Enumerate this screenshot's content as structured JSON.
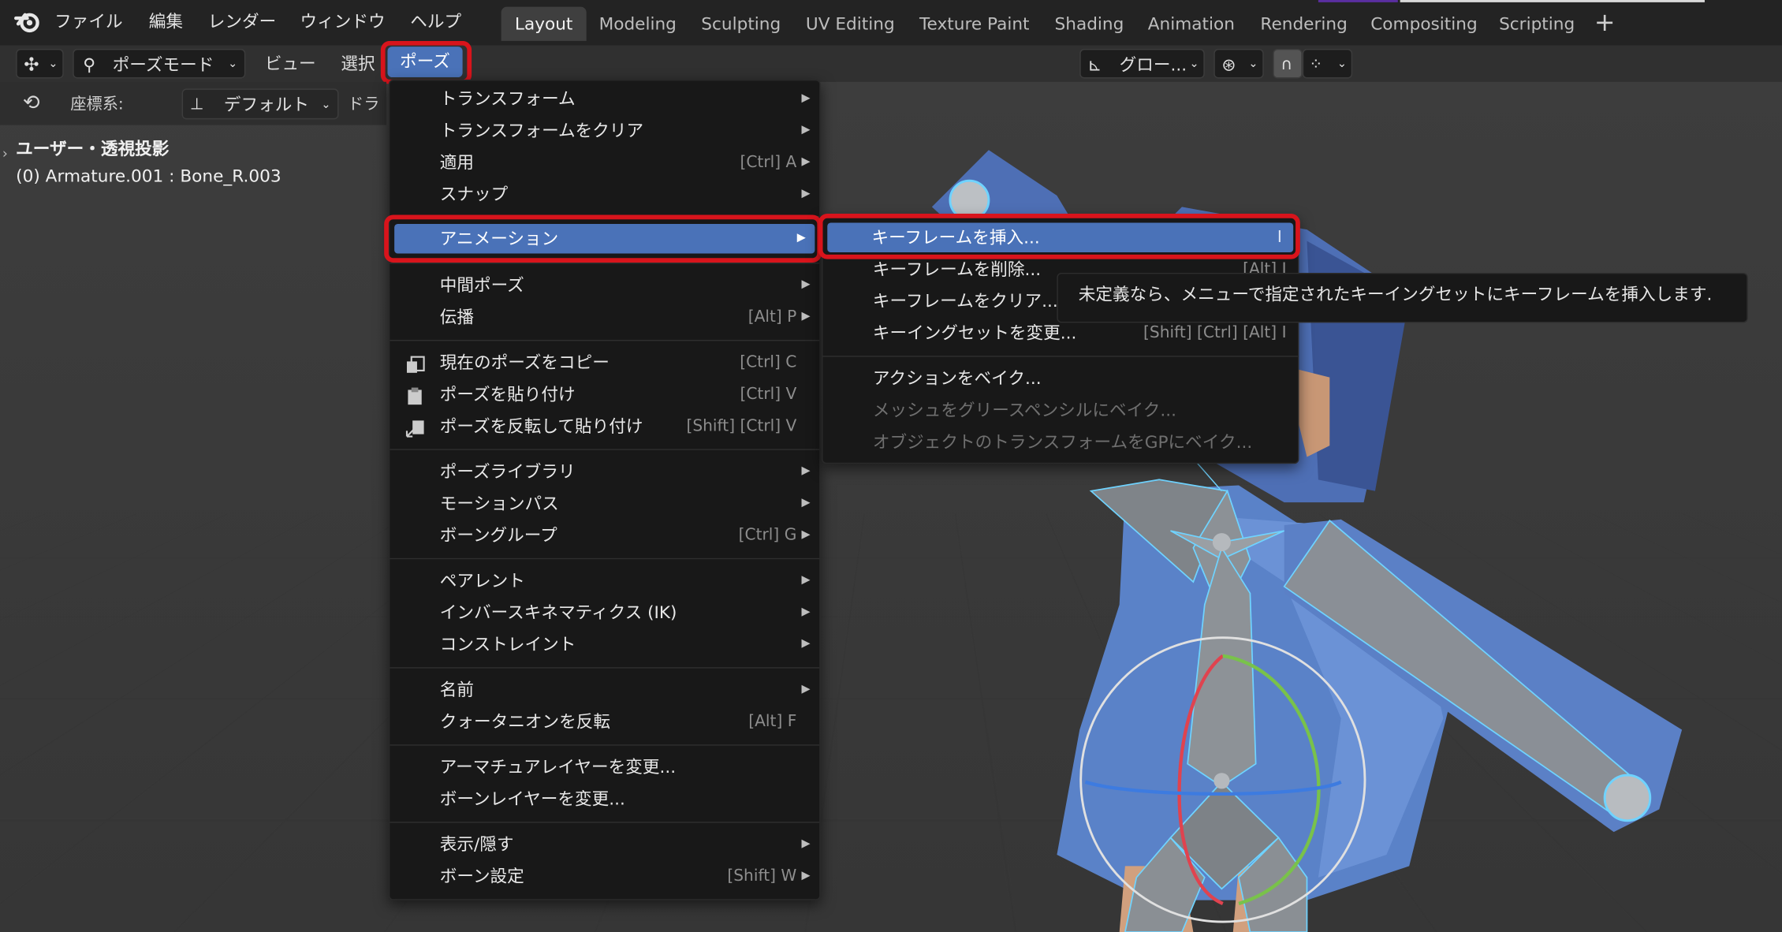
{
  "topbar": {
    "menus": [
      "ファイル",
      "編集",
      "レンダー",
      "ウィンドウ",
      "ヘルプ"
    ],
    "workspaces": [
      "Layout",
      "Modeling",
      "Sculpting",
      "UV Editing",
      "Texture Paint",
      "Shading",
      "Animation",
      "Rendering",
      "Compositing",
      "Scripting"
    ],
    "active_workspace": "Layout",
    "add_workspace": "+"
  },
  "header": {
    "mode": "ポーズモード",
    "view": "ビュー",
    "select": "選択",
    "pose": "ポーズ",
    "transform_orientation": "グロー...",
    "snap_icon": "magnet-icon"
  },
  "row3": {
    "coordinate_label": "座標系:",
    "coordinate_value": "デフォルト",
    "drag_label": "ドラ"
  },
  "overlay": {
    "view_name": "ユーザー・透視投影",
    "object_info": "(0) Armature.001 : Bone_R.003"
  },
  "pose_menu": {
    "items": [
      {
        "label": "トランスフォーム",
        "shortcut": "",
        "submenu": true
      },
      {
        "label": "トランスフォームをクリア",
        "shortcut": "",
        "submenu": true
      },
      {
        "label": "適用",
        "shortcut": "[Ctrl] A",
        "submenu": true
      },
      {
        "label": "スナップ",
        "shortcut": "",
        "submenu": true
      },
      {
        "label": "アニメーション",
        "shortcut": "",
        "submenu": true,
        "highlighted": true
      },
      {
        "label": "中間ポーズ",
        "shortcut": "",
        "submenu": true
      },
      {
        "label": "伝播",
        "shortcut": "[Alt] P",
        "submenu": true
      },
      {
        "label": "現在のポーズをコピー",
        "shortcut": "[Ctrl] C",
        "submenu": false,
        "icon": "copy-icon"
      },
      {
        "label": "ポーズを貼り付け",
        "shortcut": "[Ctrl] V",
        "submenu": false,
        "icon": "paste-icon"
      },
      {
        "label": "ポーズを反転して貼り付け",
        "shortcut": "[Shift] [Ctrl] V",
        "submenu": false,
        "icon": "paste-flipped-icon"
      },
      {
        "label": "ポーズライブラリ",
        "shortcut": "",
        "submenu": true
      },
      {
        "label": "モーションパス",
        "shortcut": "",
        "submenu": true
      },
      {
        "label": "ボーングループ",
        "shortcut": "[Ctrl] G",
        "submenu": true
      },
      {
        "label": "ペアレント",
        "shortcut": "",
        "submenu": true
      },
      {
        "label": "インバースキネマティクス (IK)",
        "shortcut": "",
        "submenu": true
      },
      {
        "label": "コンストレイント",
        "shortcut": "",
        "submenu": true
      },
      {
        "label": "名前",
        "shortcut": "",
        "submenu": true
      },
      {
        "label": "クォータニオンを反転",
        "shortcut": "[Alt] F",
        "submenu": false
      },
      {
        "label": "アーマチュアレイヤーを変更...",
        "shortcut": "",
        "submenu": false
      },
      {
        "label": "ボーンレイヤーを変更...",
        "shortcut": "",
        "submenu": false
      },
      {
        "label": "表示/隠す",
        "shortcut": "",
        "submenu": true
      },
      {
        "label": "ボーン設定",
        "shortcut": "[Shift] W",
        "submenu": true
      }
    ]
  },
  "animation_submenu": {
    "items": [
      {
        "label": "キーフレームを挿入...",
        "shortcut": "I",
        "highlighted": true,
        "disabled": false
      },
      {
        "label": "キーフレームを削除...",
        "shortcut": "[Alt] I",
        "disabled": false
      },
      {
        "label": "キーフレームをクリア...",
        "shortcut": "",
        "disabled": false
      },
      {
        "label": "キーイングセットを変更...",
        "shortcut": "[Shift] [Ctrl] [Alt] I",
        "disabled": false
      },
      {
        "label": "アクションをベイク...",
        "shortcut": "",
        "disabled": false
      },
      {
        "label": "メッシュをグリースペンシルにベイク...",
        "shortcut": "",
        "disabled": true
      },
      {
        "label": "オブジェクトのトランスフォームをGPにベイク...",
        "shortcut": "",
        "disabled": true
      }
    ]
  },
  "tooltip": {
    "text": "未定義なら、メニューで指定されたキーイングセットにキーフレームを挿入します."
  },
  "colors": {
    "highlight": "#4a72b8",
    "annotation_red": "#d8141c",
    "menu_bg": "#181818"
  }
}
